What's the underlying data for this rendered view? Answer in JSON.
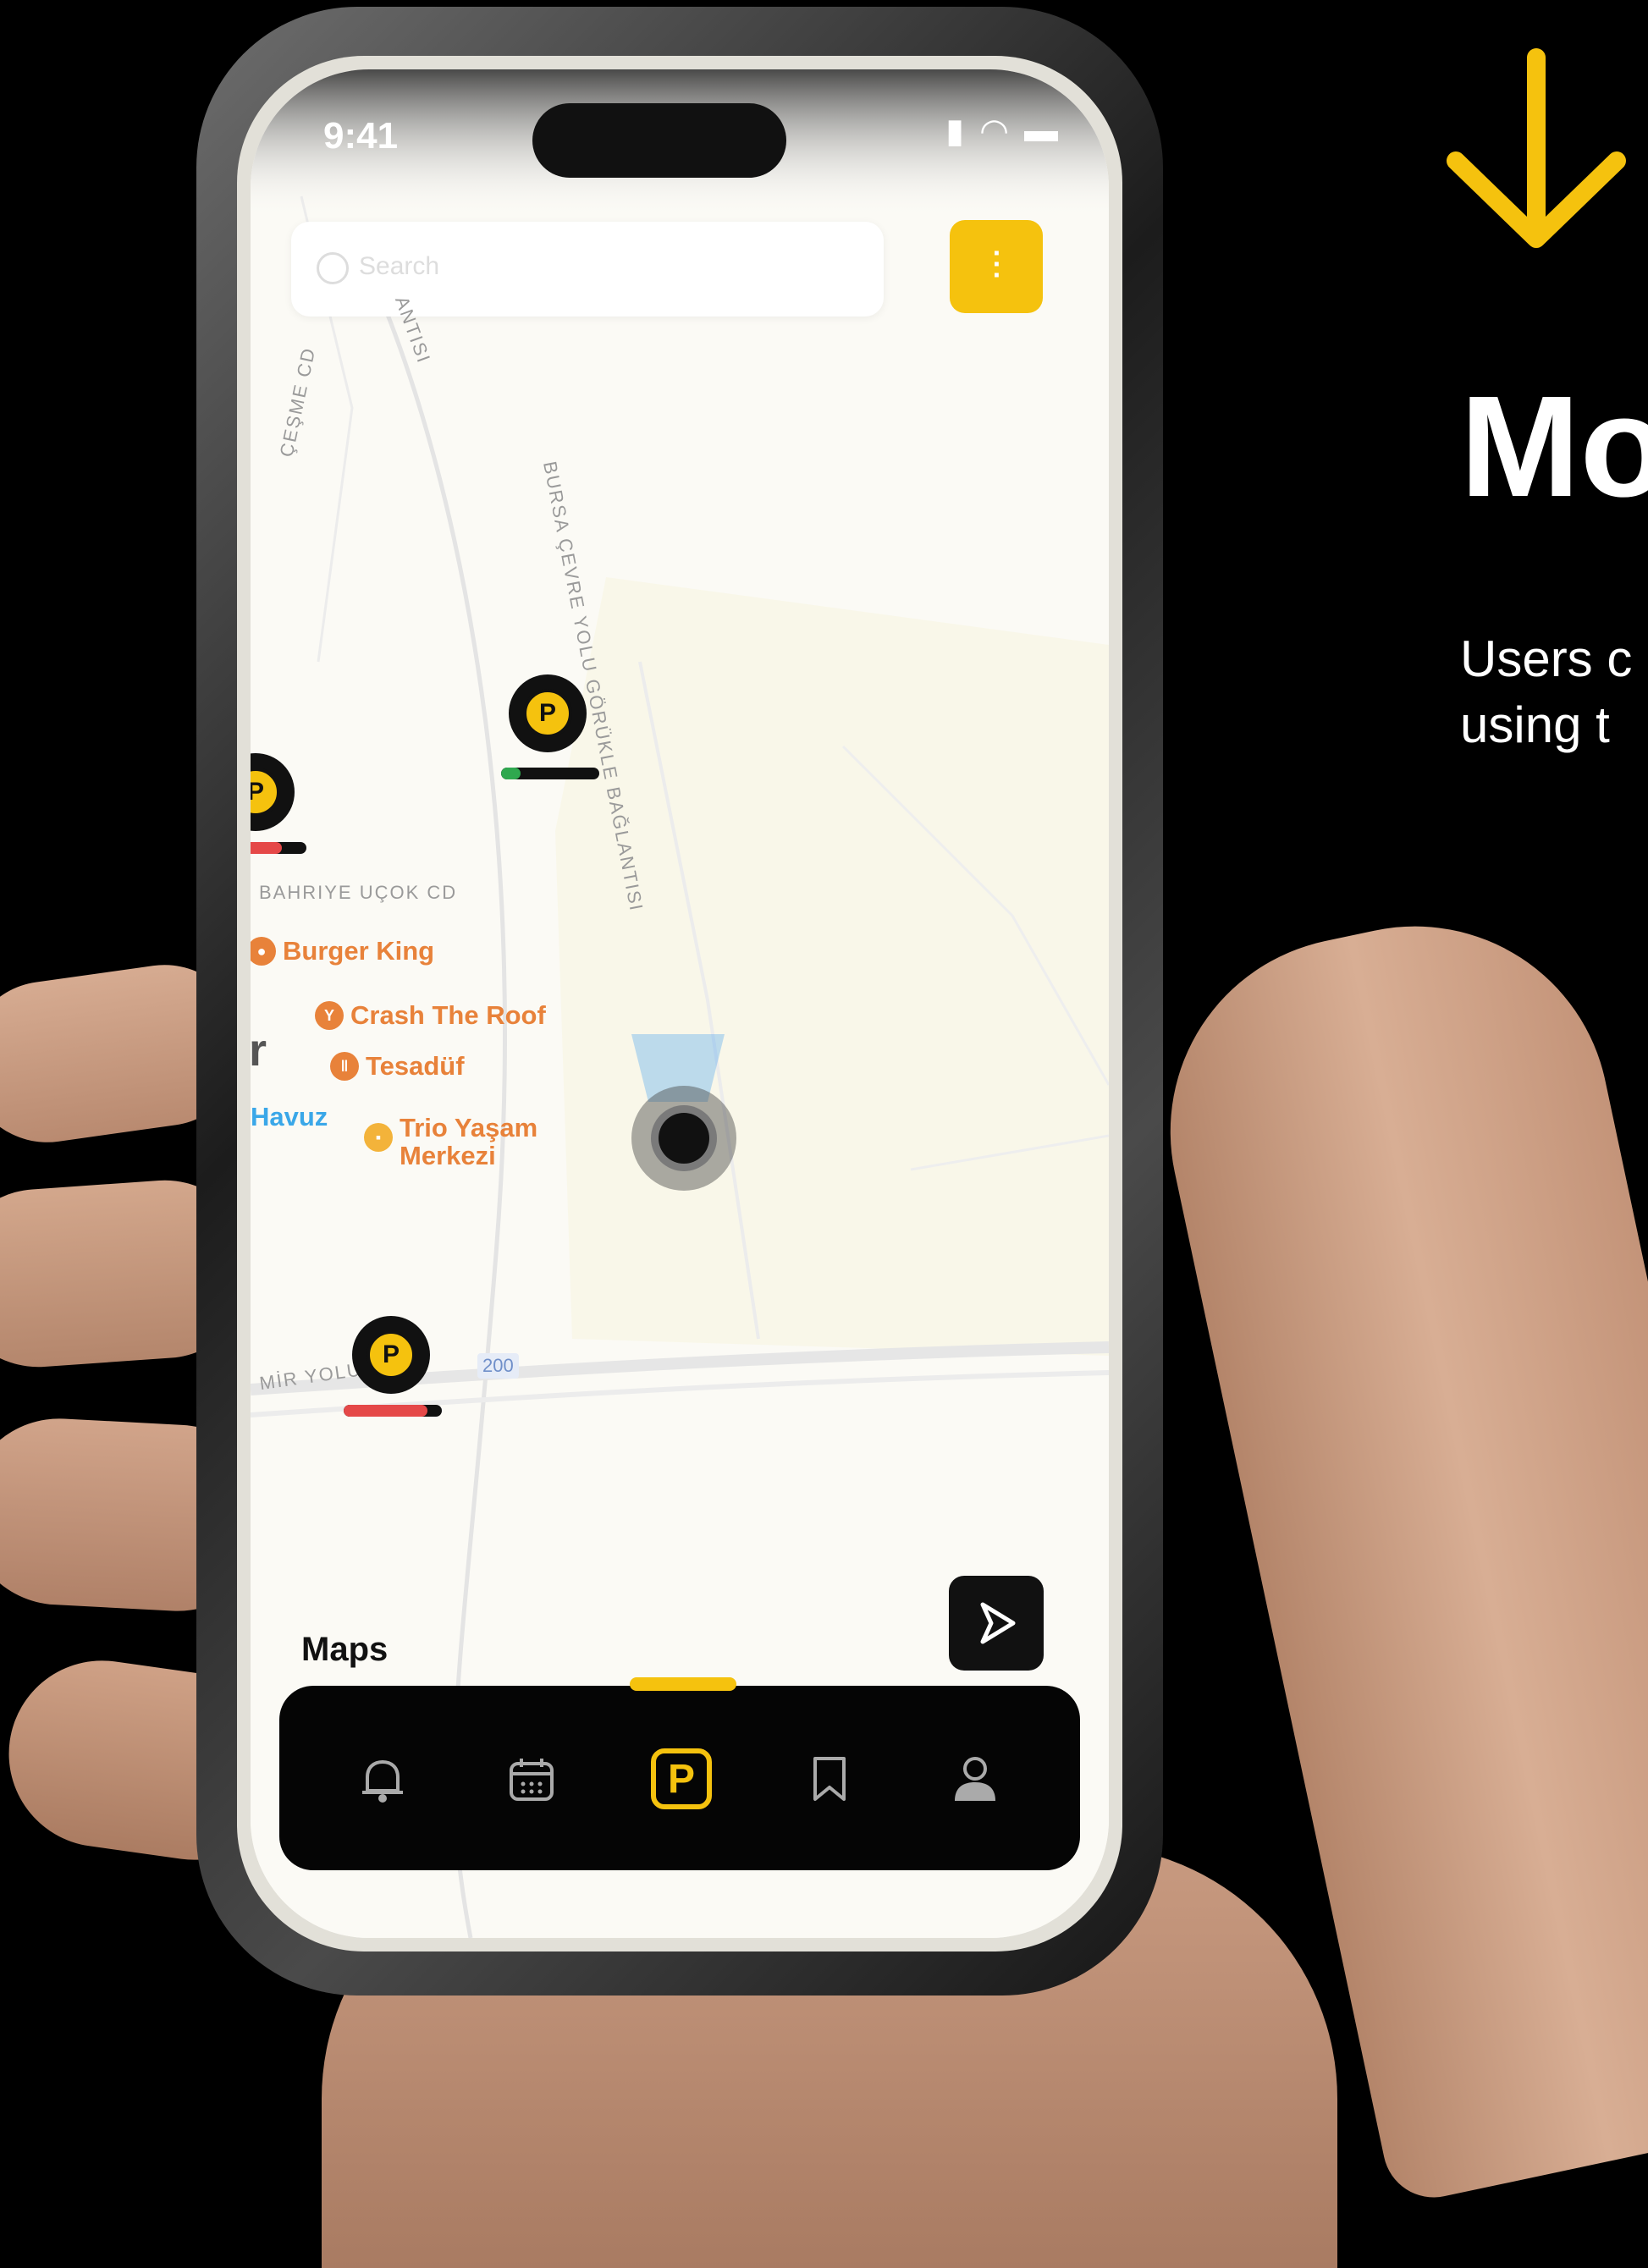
{
  "status_bar": {
    "time": "9:41"
  },
  "search": {
    "placeholder": "Search"
  },
  "map": {
    "road_labels": [
      "ANTISI",
      "ÇEŞME CD",
      "BURSA ÇEVRE YOLU GÖRÜKLE BAĞLANTISI",
      "BAHRIYE UÇOK CD",
      "MİR YOLU C",
      "200"
    ],
    "pois": [
      {
        "name": "Burger King",
        "color": "#e8823a"
      },
      {
        "name": "Crash The Roof",
        "color": "#e8823a"
      },
      {
        "name": "Tesadüf",
        "color": "#e8823a"
      },
      {
        "name": "Havuz",
        "color": "#3aa7e8"
      },
      {
        "name": "Trio Yaşam\nMerkezi",
        "color": "#e8823a"
      }
    ],
    "fragment_letter": "r",
    "pins": [
      {
        "label": "P",
        "occupancy_color": "#2fa84f",
        "fill_fraction": 0.2
      },
      {
        "label": "P",
        "occupancy_color": "#e54848",
        "fill_fraction": 0.75
      },
      {
        "label": "P",
        "occupancy_color": "#e54848",
        "fill_fraction": 0.85
      }
    ],
    "attribution": "Maps"
  },
  "tabbar": {
    "tabs": [
      "notifications",
      "calendar",
      "parking",
      "saved",
      "profile"
    ],
    "active_tab": "parking",
    "parking_label": "P"
  },
  "promo": {
    "headline": "Mo",
    "subtext": "Users c\nusing t"
  },
  "colors": {
    "accent": "#f5c20e",
    "tabbar": "#050505"
  }
}
